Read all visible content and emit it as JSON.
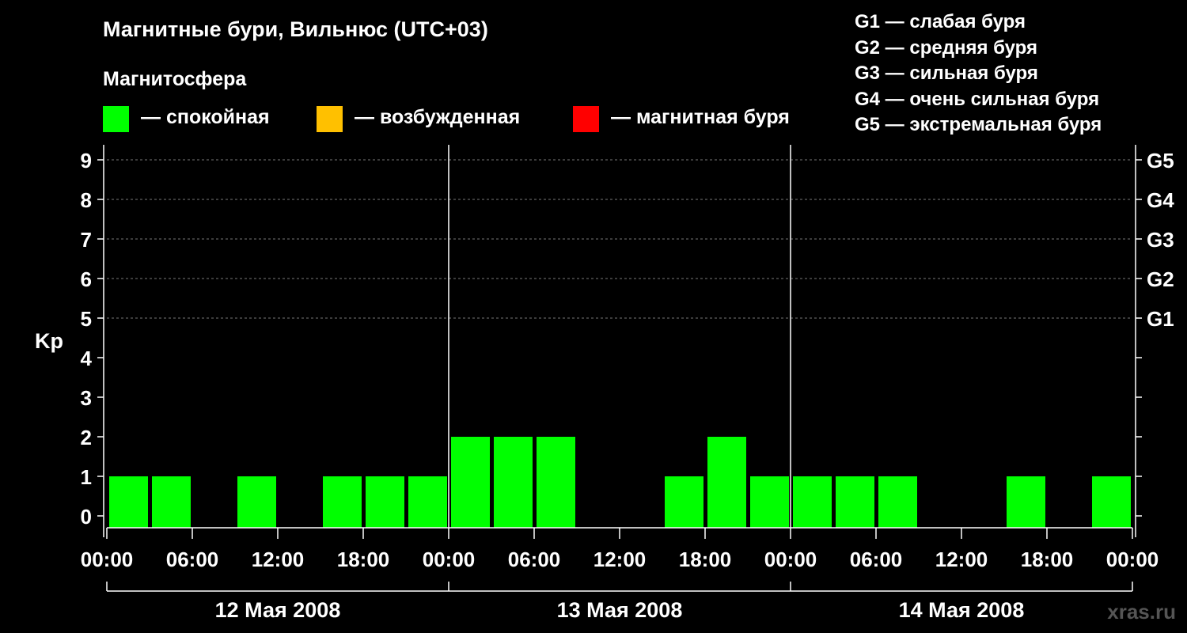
{
  "title": "Магнитные бури, Вильнюс (UTC+03)",
  "subtitle": "Магнитосфера",
  "legend": [
    {
      "label": "— спокойная",
      "color": "#00ff00"
    },
    {
      "label": "— возбужденная",
      "color": "#ffc000"
    },
    {
      "label": "— магнитная буря",
      "color": "#ff0000"
    }
  ],
  "g_scale": [
    "G1 — слабая буря",
    "G2 — средняя буря",
    "G3 — сильная буря",
    "G4 — очень сильная буря",
    "G5 — экстремальная буря"
  ],
  "watermark": "xras.ru",
  "chart_data": {
    "type": "bar",
    "ylabel": "Kp",
    "ylim": [
      0,
      9
    ],
    "y_ticks": [
      "0",
      "1",
      "2",
      "3",
      "4",
      "5",
      "6",
      "7",
      "8",
      "9"
    ],
    "right_ticks": [
      {
        "value": 5,
        "label": "G1"
      },
      {
        "value": 6,
        "label": "G2"
      },
      {
        "value": 7,
        "label": "G3"
      },
      {
        "value": 8,
        "label": "G4"
      },
      {
        "value": 9,
        "label": "G5"
      }
    ],
    "x_ticks": [
      "00:00",
      "06:00",
      "12:00",
      "18:00",
      "00:00",
      "06:00",
      "12:00",
      "18:00",
      "00:00",
      "06:00",
      "12:00",
      "18:00",
      "00:00"
    ],
    "days": [
      "12 Мая 2008",
      "13 Мая 2008",
      "14 Мая 2008"
    ],
    "intervals_per_day": 8,
    "values": [
      1,
      1,
      0,
      1,
      0,
      1,
      1,
      1,
      2,
      2,
      2,
      0,
      0,
      1,
      2,
      1,
      1,
      1,
      1,
      0,
      0,
      1,
      0,
      1
    ],
    "bar_color": "#00ff00",
    "grid": "dashed at 5-9"
  }
}
